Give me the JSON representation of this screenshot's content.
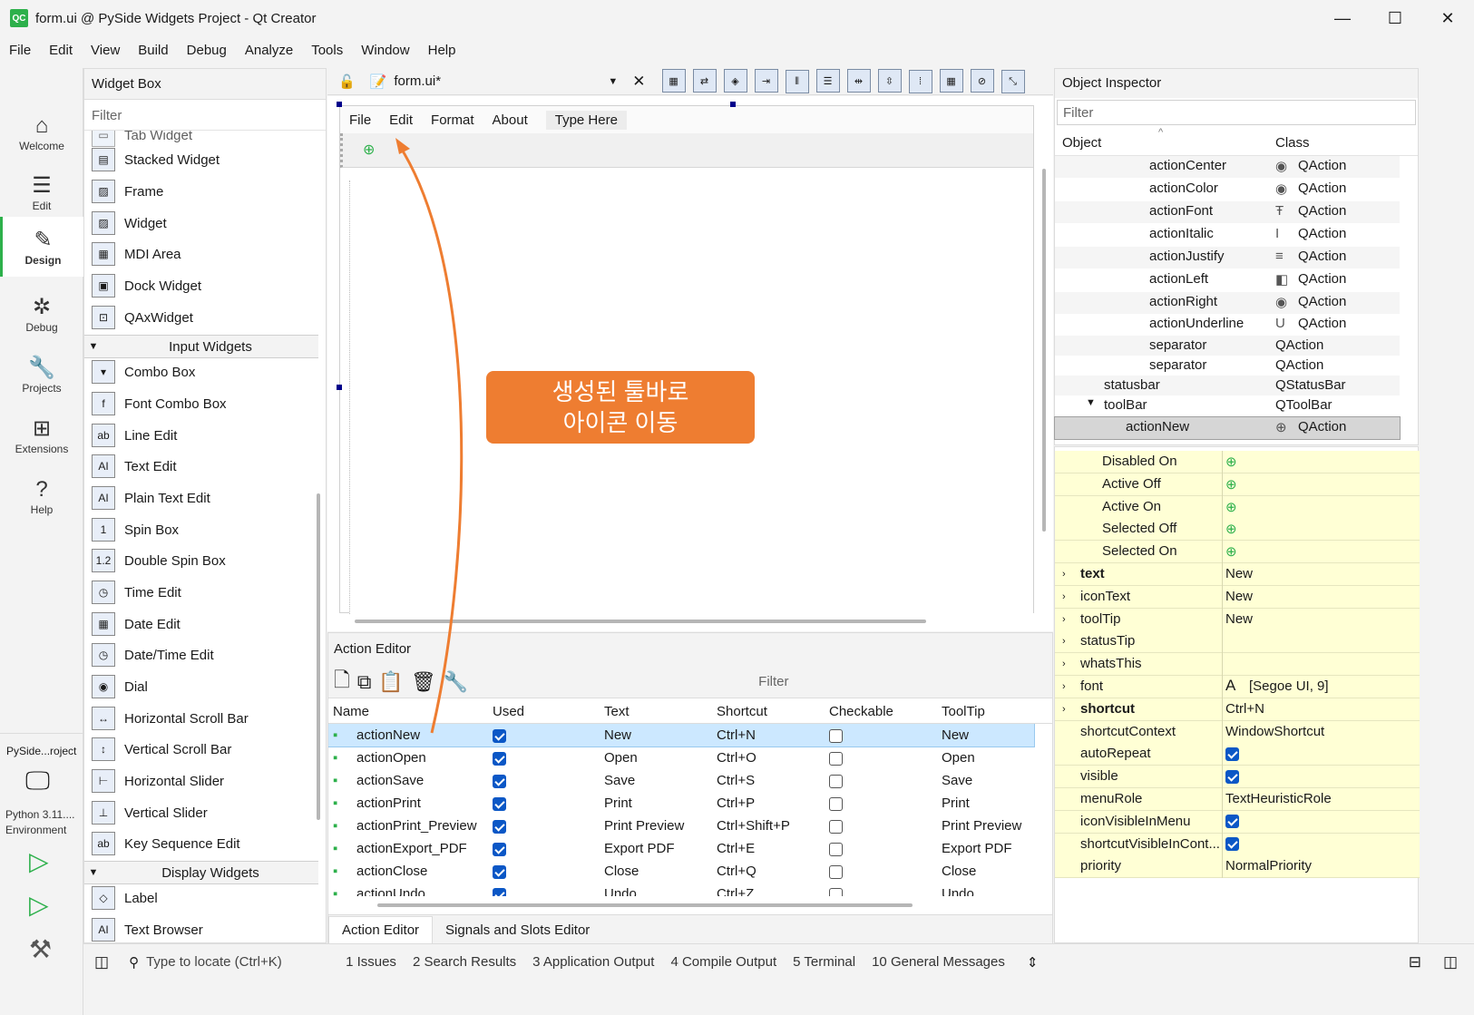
{
  "window": {
    "title": "form.ui @ PySide Widgets Project - Qt Creator",
    "logo": "QC",
    "minimize": "—",
    "maximize": "☐",
    "close": "✕"
  },
  "menubar": [
    "File",
    "Edit",
    "View",
    "Build",
    "Debug",
    "Analyze",
    "Tools",
    "Window",
    "Help"
  ],
  "modes": [
    {
      "label": "Welcome",
      "icon": "home-icon"
    },
    {
      "label": "Edit",
      "icon": "lines-icon"
    },
    {
      "label": "Design",
      "icon": "pen-icon"
    },
    {
      "label": "Debug",
      "icon": "bug-icon"
    },
    {
      "label": "Projects",
      "icon": "wrench-icon"
    },
    {
      "label": "Extensions",
      "icon": "grid-icon"
    },
    {
      "label": "Help",
      "icon": "help-icon"
    }
  ],
  "kit": {
    "project": "PySide...roject",
    "env1": "Python 3.11....",
    "env2": "Environment"
  },
  "widget_box": {
    "title": "Widget Box",
    "filter": "Filter",
    "partial": "Tab Widget",
    "containers": [
      "Stacked Widget",
      "Frame",
      "Widget",
      "MDI Area",
      "Dock Widget",
      "QAxWidget"
    ],
    "cat_input": "Input Widgets",
    "inputs": [
      "Combo Box",
      "Font Combo Box",
      "Line Edit",
      "Text Edit",
      "Plain Text Edit",
      "Spin Box",
      "Double Spin Box",
      "Time Edit",
      "Date Edit",
      "Date/Time Edit",
      "Dial",
      "Horizontal Scroll Bar",
      "Vertical Scroll Bar",
      "Horizontal Slider",
      "Vertical Slider",
      "Key Sequence Edit"
    ],
    "cat_display": "Display Widgets",
    "display": [
      "Label",
      "Text Browser"
    ]
  },
  "editor": {
    "file": "form.ui*",
    "form_menu": [
      "File",
      "Edit",
      "Format",
      "About",
      "Type Here"
    ]
  },
  "callout": {
    "line1": "생성된 툴바로",
    "line2": "아이콘 이동"
  },
  "action_editor": {
    "title": "Action Editor",
    "filter": "Filter",
    "columns": [
      "Name",
      "Used",
      "Text",
      "Shortcut",
      "Checkable",
      "ToolTip"
    ],
    "rows": [
      {
        "name": "actionNew",
        "used": true,
        "text": "New",
        "shortcut": "Ctrl+N",
        "checkable": false,
        "tooltip": "New",
        "sel": true
      },
      {
        "name": "actionOpen",
        "used": true,
        "text": "Open",
        "shortcut": "Ctrl+O",
        "checkable": false,
        "tooltip": "Open"
      },
      {
        "name": "actionSave",
        "used": true,
        "text": "Save",
        "shortcut": "Ctrl+S",
        "checkable": false,
        "tooltip": "Save"
      },
      {
        "name": "actionPrint",
        "used": true,
        "text": "Print",
        "shortcut": "Ctrl+P",
        "checkable": false,
        "tooltip": "Print"
      },
      {
        "name": "actionPrint_Preview",
        "used": true,
        "text": "Print Preview",
        "shortcut": "Ctrl+Shift+P",
        "checkable": false,
        "tooltip": "Print Preview"
      },
      {
        "name": "actionExport_PDF",
        "used": true,
        "text": "Export PDF",
        "shortcut": "Ctrl+E",
        "checkable": false,
        "tooltip": "Export PDF"
      },
      {
        "name": "actionClose",
        "used": true,
        "text": "Close",
        "shortcut": "Ctrl+Q",
        "checkable": false,
        "tooltip": "Close"
      },
      {
        "name": "actionUndo",
        "used": true,
        "text": "Undo",
        "shortcut": "Ctrl+Z",
        "checkable": false,
        "tooltip": "Undo"
      }
    ],
    "tabs": [
      "Action Editor",
      "Signals and Slots Editor"
    ]
  },
  "object_inspector": {
    "title": "Object Inspector",
    "filter": "Filter",
    "col_object": "Object",
    "col_class": "Class",
    "rows": [
      {
        "name": "actionCenter",
        "cls": "QAction"
      },
      {
        "name": "actionColor",
        "cls": "QAction"
      },
      {
        "name": "actionFont",
        "cls": "QAction"
      },
      {
        "name": "actionItalic",
        "cls": "QAction"
      },
      {
        "name": "actionJustify",
        "cls": "QAction"
      },
      {
        "name": "actionLeft",
        "cls": "QAction"
      },
      {
        "name": "actionRight",
        "cls": "QAction"
      },
      {
        "name": "actionUnderline",
        "cls": "QAction"
      },
      {
        "name": "separator",
        "cls": "QAction"
      },
      {
        "name": "separator",
        "cls": "QAction"
      },
      {
        "name": "statusbar",
        "cls": "QStatusBar"
      },
      {
        "name": "toolBar",
        "cls": "QToolBar"
      },
      {
        "name": "actionNew",
        "cls": "QAction"
      }
    ]
  },
  "property_editor": {
    "rows": [
      {
        "name": "Disabled On",
        "val": ""
      },
      {
        "name": "Active Off",
        "val": ""
      },
      {
        "name": "Active On",
        "val": ""
      },
      {
        "name": "Selected Off",
        "val": ""
      },
      {
        "name": "Selected On",
        "val": ""
      },
      {
        "name": "text",
        "val": "New"
      },
      {
        "name": "iconText",
        "val": "New"
      },
      {
        "name": "toolTip",
        "val": "New"
      },
      {
        "name": "statusTip",
        "val": ""
      },
      {
        "name": "whatsThis",
        "val": ""
      },
      {
        "name": "font",
        "val": "[Segoe UI, 9]"
      },
      {
        "name": "shortcut",
        "val": "Ctrl+N"
      },
      {
        "name": "shortcutContext",
        "val": "WindowShortcut"
      },
      {
        "name": "autoRepeat",
        "val": ""
      },
      {
        "name": "visible",
        "val": ""
      },
      {
        "name": "menuRole",
        "val": "TextHeuristicRole"
      },
      {
        "name": "iconVisibleInMenu",
        "val": ""
      },
      {
        "name": "shortcutVisibleInCont...",
        "val": ""
      },
      {
        "name": "priority",
        "val": "NormalPriority"
      }
    ]
  },
  "statusbar": {
    "locate": "Type to locate (Ctrl+K)",
    "tabs": [
      "1  Issues",
      "2  Search Results",
      "3  Application Output",
      "4  Compile Output",
      "5  Terminal",
      "10  General Messages"
    ]
  },
  "colors": {
    "accent": "#2db04b",
    "selection": "#cce8ff",
    "callout": "#ee7d31",
    "property_bg": "#ffffd5"
  }
}
